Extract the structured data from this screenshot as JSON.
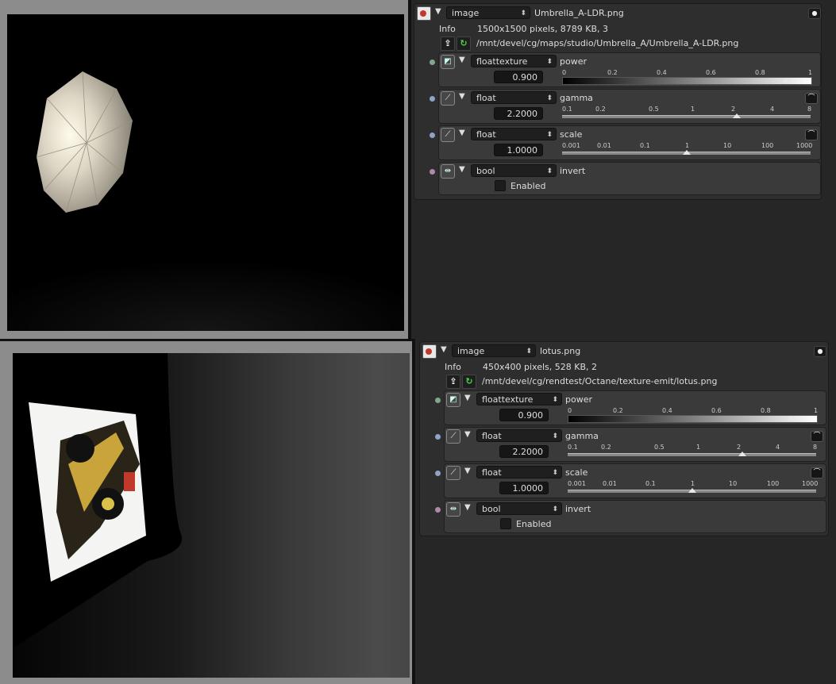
{
  "panels": [
    {
      "node_type": "image",
      "filename": "Umbrella_A-LDR.png",
      "info_label": "Info",
      "info_text": "1500x1500 pixels, 8789 KB, 3",
      "path": "/mnt/devel/cg/maps/studio/Umbrella_A/Umbrella_A-LDR.png",
      "power": {
        "type": "floattexture",
        "name": "power",
        "value": "0.900",
        "fraction": 0.9,
        "ticks": [
          "0",
          "0.2",
          "0.4",
          "0.6",
          "0.8",
          "1"
        ]
      },
      "gamma": {
        "type": "float",
        "name": "gamma",
        "value": "2.2000",
        "ticks": [
          "0.1",
          "0.2",
          "0.5",
          "1",
          "2",
          "4",
          "8"
        ]
      },
      "scale": {
        "type": "float",
        "name": "scale",
        "value": "1.0000",
        "ticks": [
          "0.001",
          "0.01",
          "0.1",
          "1",
          "10",
          "100",
          "1000"
        ]
      },
      "invert": {
        "type": "bool",
        "name": "invert",
        "checkbox_label": "Enabled"
      }
    },
    {
      "node_type": "image",
      "filename": "lotus.png",
      "info_label": "Info",
      "info_text": "450x400 pixels, 528 KB, 2",
      "path": "/mnt/devel/cg/rendtest/Octane/texture-emit/lotus.png",
      "power": {
        "type": "floattexture",
        "name": "power",
        "value": "0.900",
        "fraction": 0.9,
        "ticks": [
          "0",
          "0.2",
          "0.4",
          "0.6",
          "0.8",
          "1"
        ]
      },
      "gamma": {
        "type": "float",
        "name": "gamma",
        "value": "2.2000",
        "ticks": [
          "0.1",
          "0.2",
          "0.5",
          "1",
          "2",
          "4",
          "8"
        ]
      },
      "scale": {
        "type": "float",
        "name": "scale",
        "value": "1.0000",
        "ticks": [
          "0.001",
          "0.01",
          "0.1",
          "1",
          "10",
          "100",
          "1000"
        ]
      },
      "invert": {
        "type": "bool",
        "name": "invert",
        "checkbox_label": "Enabled"
      }
    }
  ],
  "colors": {
    "pin_texture": "#7fa88a",
    "pin_float": "#8fa2c8",
    "pin_bool": "#b089a8",
    "accent_reload": "#4cd34c"
  },
  "icons": {
    "node": "image-node-icon",
    "load": "load-file-icon",
    "reload": "reload-icon",
    "eye": "eye-icon",
    "curve": "curve-icon"
  }
}
